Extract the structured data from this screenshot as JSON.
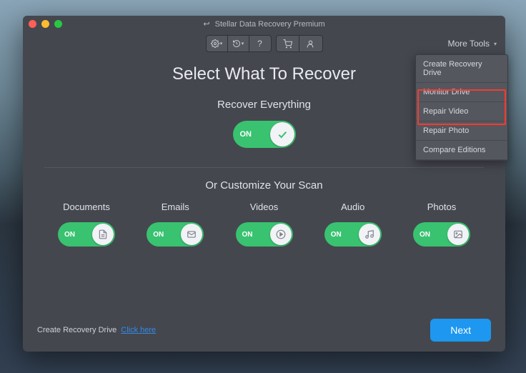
{
  "window": {
    "title": "Stellar Data Recovery Premium"
  },
  "toolbar": {
    "more_tools_label": "More Tools"
  },
  "dropdown": {
    "items": [
      "Create Recovery Drive",
      "Monitor Drive",
      "Repair Video",
      "Repair Photo",
      "Compare Editions"
    ]
  },
  "main": {
    "heading": "Select What To Recover",
    "recover_all_label": "Recover Everything",
    "customize_label": "Or Customize Your Scan",
    "on_label": "ON"
  },
  "categories": [
    {
      "label": "Documents",
      "icon": "document"
    },
    {
      "label": "Emails",
      "icon": "email"
    },
    {
      "label": "Videos",
      "icon": "video"
    },
    {
      "label": "Audio",
      "icon": "audio"
    },
    {
      "label": "Photos",
      "icon": "photo"
    }
  ],
  "footer": {
    "text": "Create Recovery Drive",
    "link": "Click here",
    "next": "Next"
  }
}
